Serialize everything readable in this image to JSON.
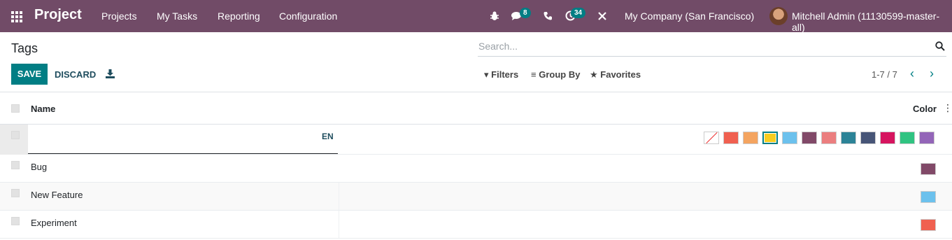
{
  "navbar": {
    "brand": "Project",
    "menu": [
      "Projects",
      "My Tasks",
      "Reporting",
      "Configuration"
    ],
    "messages_count": "8",
    "activities_count": "34",
    "company": "My Company (San Francisco)",
    "user": "Mitchell Admin (11130599-master-all)",
    "icons": [
      "apps-icon",
      "bug-icon",
      "chat-icon",
      "phone-icon",
      "clock-icon",
      "tools-icon"
    ]
  },
  "control_panel": {
    "title": "Tags",
    "search_placeholder": "Search...",
    "save_label": "SAVE",
    "discard_label": "DISCARD",
    "filters_label": "Filters",
    "groupby_label": "Group By",
    "favorites_label": "Favorites",
    "pager": "1-7 / 7"
  },
  "list": {
    "columns": {
      "name": "Name",
      "color": "Color"
    },
    "edit_row": {
      "value": "",
      "lang": "EN",
      "palette": [
        "none",
        "#F06050",
        "#F4A460",
        "#F7CD1F",
        "#6CC1ED",
        "#814968",
        "#EB7E7F",
        "#2C8397",
        "#475577",
        "#D6145F",
        "#30C381",
        "#9365B8"
      ],
      "selected_index": 3
    },
    "rows": [
      {
        "name": "Bug",
        "color": "#814968"
      },
      {
        "name": "New Feature",
        "color": "#6CC1ED"
      },
      {
        "name": "Experiment",
        "color": "#F06050"
      }
    ]
  }
}
